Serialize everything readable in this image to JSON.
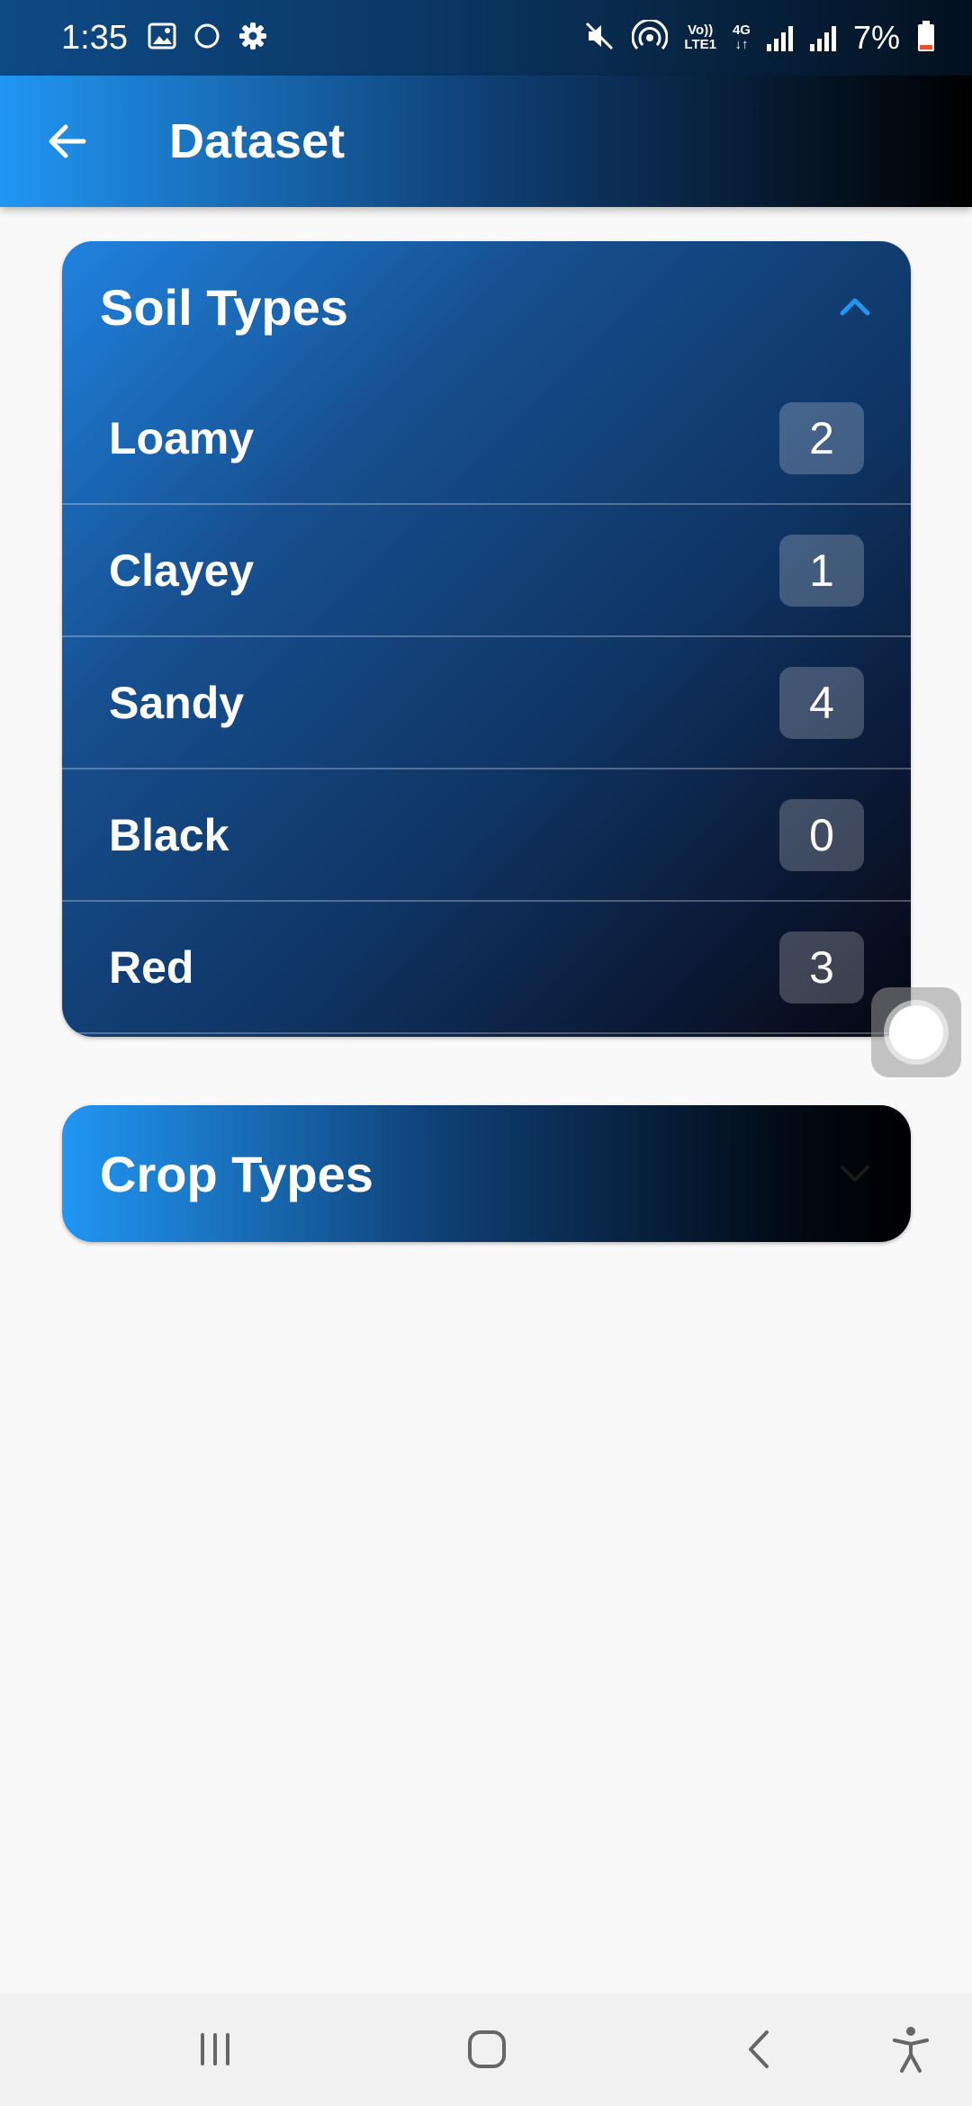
{
  "status_bar": {
    "time": "1:35",
    "network_top": "Vo))",
    "network_bottom": "LTE1",
    "network_type": "4G",
    "battery": "7%",
    "icons": [
      "gallery-icon",
      "circle-icon",
      "settings-icon",
      "mute-icon",
      "hotspot-icon",
      "signal-icon",
      "signal-icon",
      "battery-icon"
    ]
  },
  "app_bar": {
    "title": "Dataset",
    "back_icon": "arrow-back-icon"
  },
  "soil_section": {
    "title": "Soil Types",
    "expanded": true,
    "items": [
      {
        "label": "Loamy",
        "count": "2"
      },
      {
        "label": "Clayey",
        "count": "1"
      },
      {
        "label": "Sandy",
        "count": "4"
      },
      {
        "label": "Black",
        "count": "0"
      },
      {
        "label": "Red",
        "count": "3"
      }
    ]
  },
  "crop_section": {
    "title": "Crop Types",
    "expanded": false
  },
  "nav_bar": {
    "icons": [
      "recent-apps-icon",
      "home-icon",
      "back-icon",
      "accessibility-icon"
    ]
  },
  "colors": {
    "accent": "#2196f3",
    "background": "#f9f9f9"
  }
}
